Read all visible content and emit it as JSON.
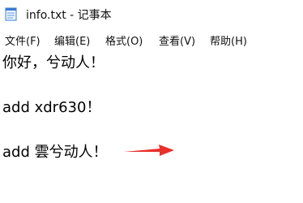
{
  "window": {
    "title": "info.txt - 记事本",
    "icon": "notepad-icon"
  },
  "menubar": {
    "items": [
      {
        "label": "文件(F)"
      },
      {
        "label": "编辑(E)"
      },
      {
        "label": "格式(O)"
      },
      {
        "label": "查看(V)"
      },
      {
        "label": "帮助(H)"
      }
    ]
  },
  "editor": {
    "lines": [
      "你好，兮动人！",
      "add xdr630！",
      "add 雲兮动人！"
    ]
  },
  "annotation": {
    "icon": "red-arrow-icon",
    "color": "#e8312a"
  }
}
